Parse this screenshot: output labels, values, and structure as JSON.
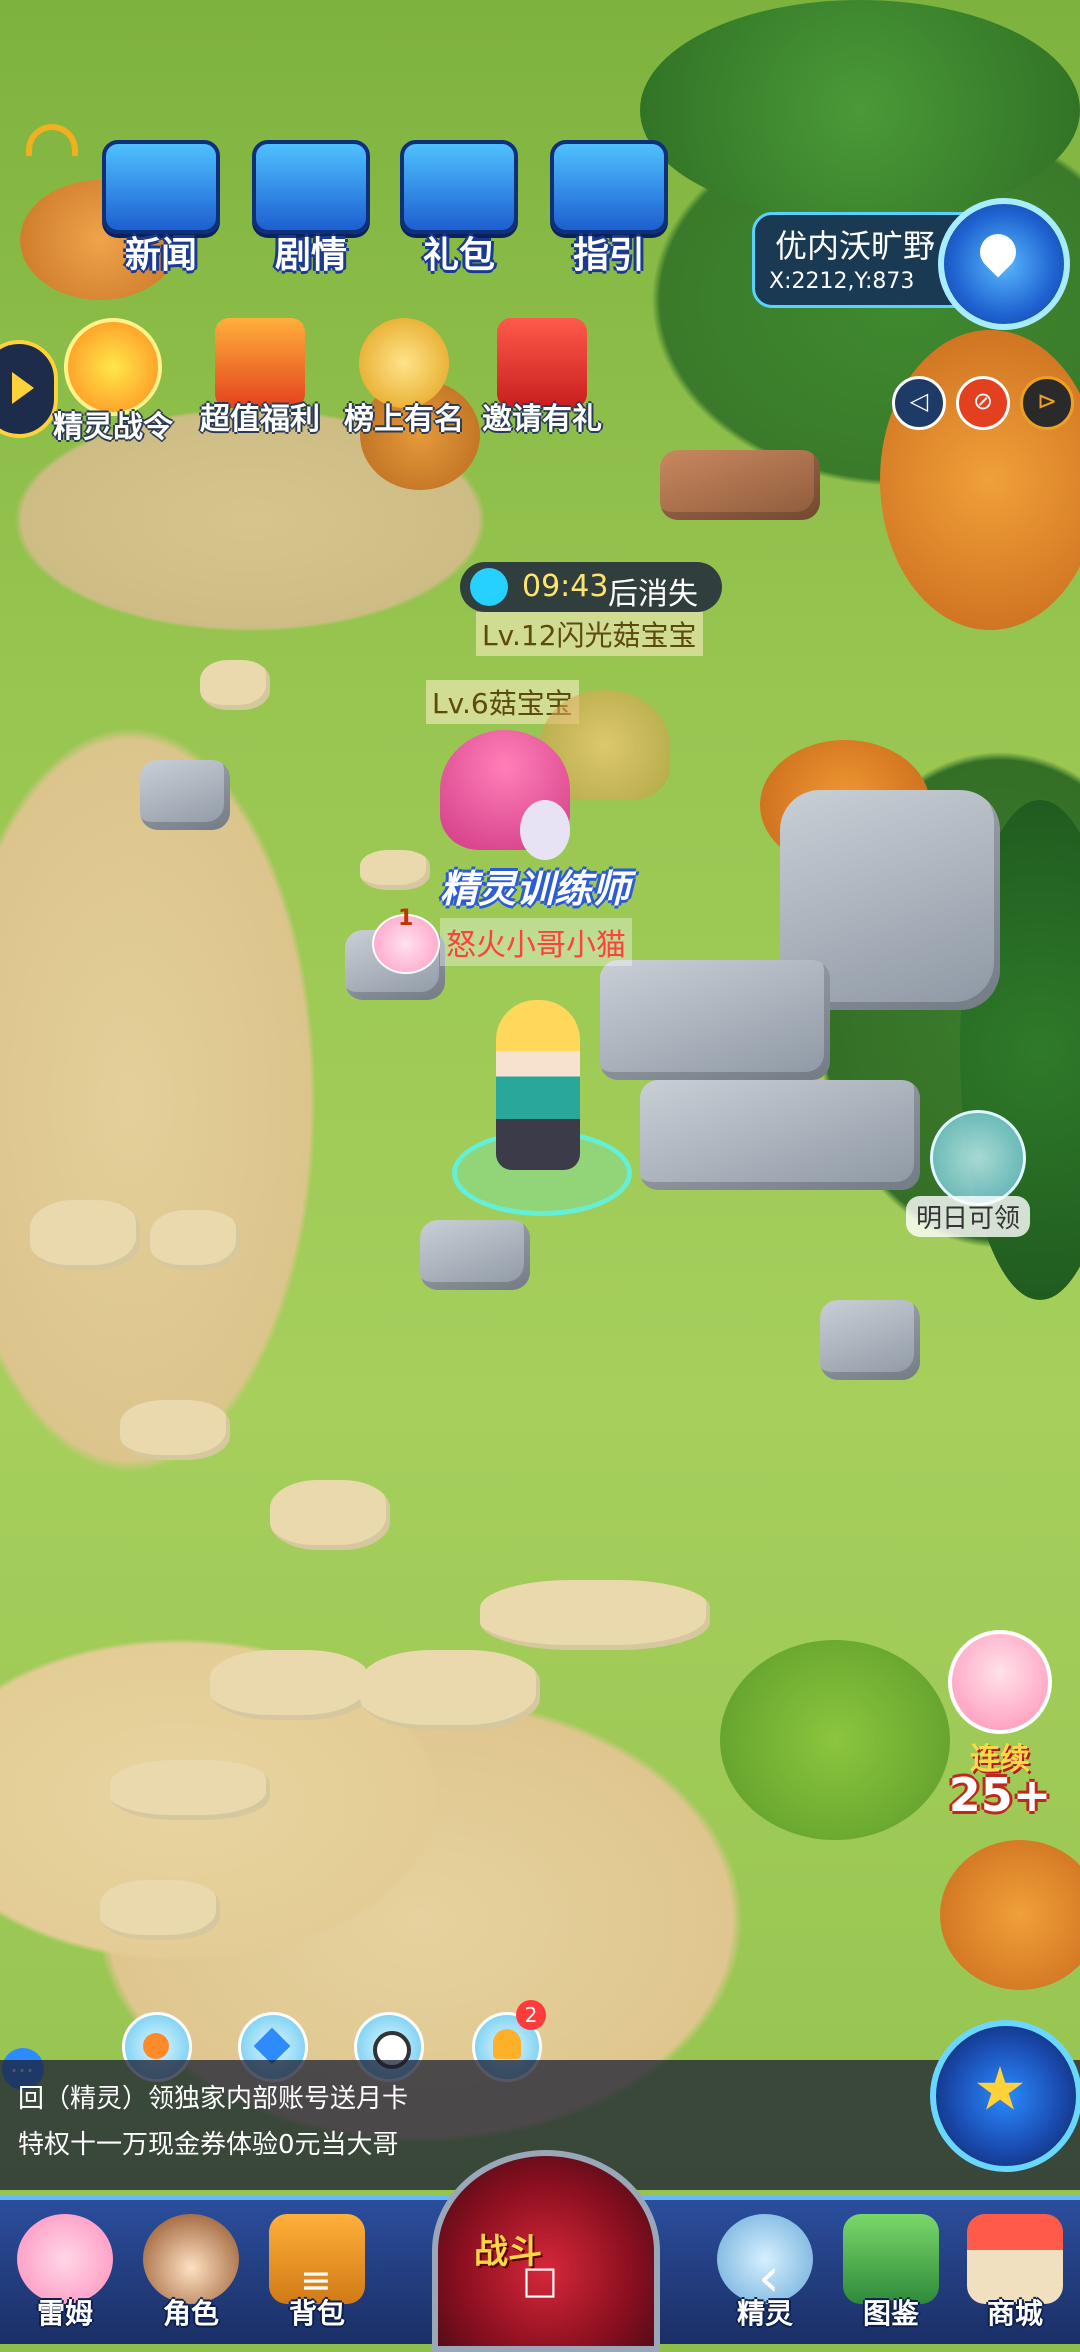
{
  "top_menu": [
    {
      "label": "新闻"
    },
    {
      "label": "剧情"
    },
    {
      "label": "礼包"
    },
    {
      "label": "指引"
    }
  ],
  "activities": [
    {
      "label": "精灵战令"
    },
    {
      "label": "超值福利"
    },
    {
      "label": "榜上有名"
    },
    {
      "label": "邀请有礼"
    }
  ],
  "location": {
    "name": "优内沃旷野",
    "coords": "X:2212,Y:873"
  },
  "timer": {
    "time": "09:43",
    "suffix": "后消失"
  },
  "monsters": [
    {
      "label": "Lv.12闪光菇宝宝"
    },
    {
      "label": "Lv.6菇宝宝"
    }
  ],
  "player": {
    "title": "精灵训练师",
    "name": "怒火小哥小猫",
    "level_badge": "1"
  },
  "bubble": {
    "label": "明日可领"
  },
  "promo": {
    "streak": "连续",
    "count": "25+"
  },
  "quick_buttons": {
    "notice_badge": "2"
  },
  "chat": {
    "line1": "回（精灵）领独家内部账号送月卡",
    "line2": "特权十一万现金券体验0元当大哥"
  },
  "bottom_nav": [
    {
      "label": "雷姆"
    },
    {
      "label": "角色"
    },
    {
      "label": "背包"
    },
    {
      "label": "战斗"
    },
    {
      "label": "精灵"
    },
    {
      "label": "图鉴"
    },
    {
      "label": "商城"
    }
  ],
  "system_nav": {
    "menu": "≡",
    "home": "□",
    "back": "‹"
  }
}
